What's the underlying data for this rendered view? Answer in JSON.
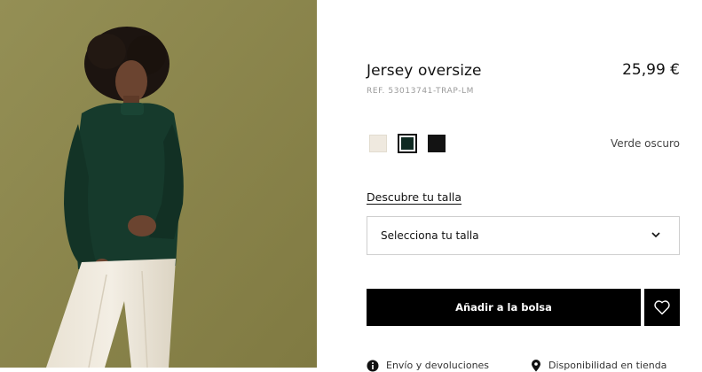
{
  "product": {
    "title": "Jersey oversize",
    "price": "25,99 €",
    "reference": "REF. 53013741-TRAP-LM"
  },
  "colors": {
    "swatches": [
      {
        "name": "crudo",
        "hex": "#efe9df"
      },
      {
        "name": "verde-oscuro",
        "hex": "#0f2a22"
      },
      {
        "name": "negro",
        "hex": "#131313"
      }
    ],
    "selected_label": "Verde oscuro"
  },
  "size": {
    "guide_link": "Descubre tu talla",
    "select_placeholder": "Selecciona tu talla"
  },
  "actions": {
    "add_to_bag": "Añadir a la bolsa"
  },
  "info_row": {
    "item1": "Envío y devoluciones",
    "item2": "Disponibilidad en tienda"
  }
}
